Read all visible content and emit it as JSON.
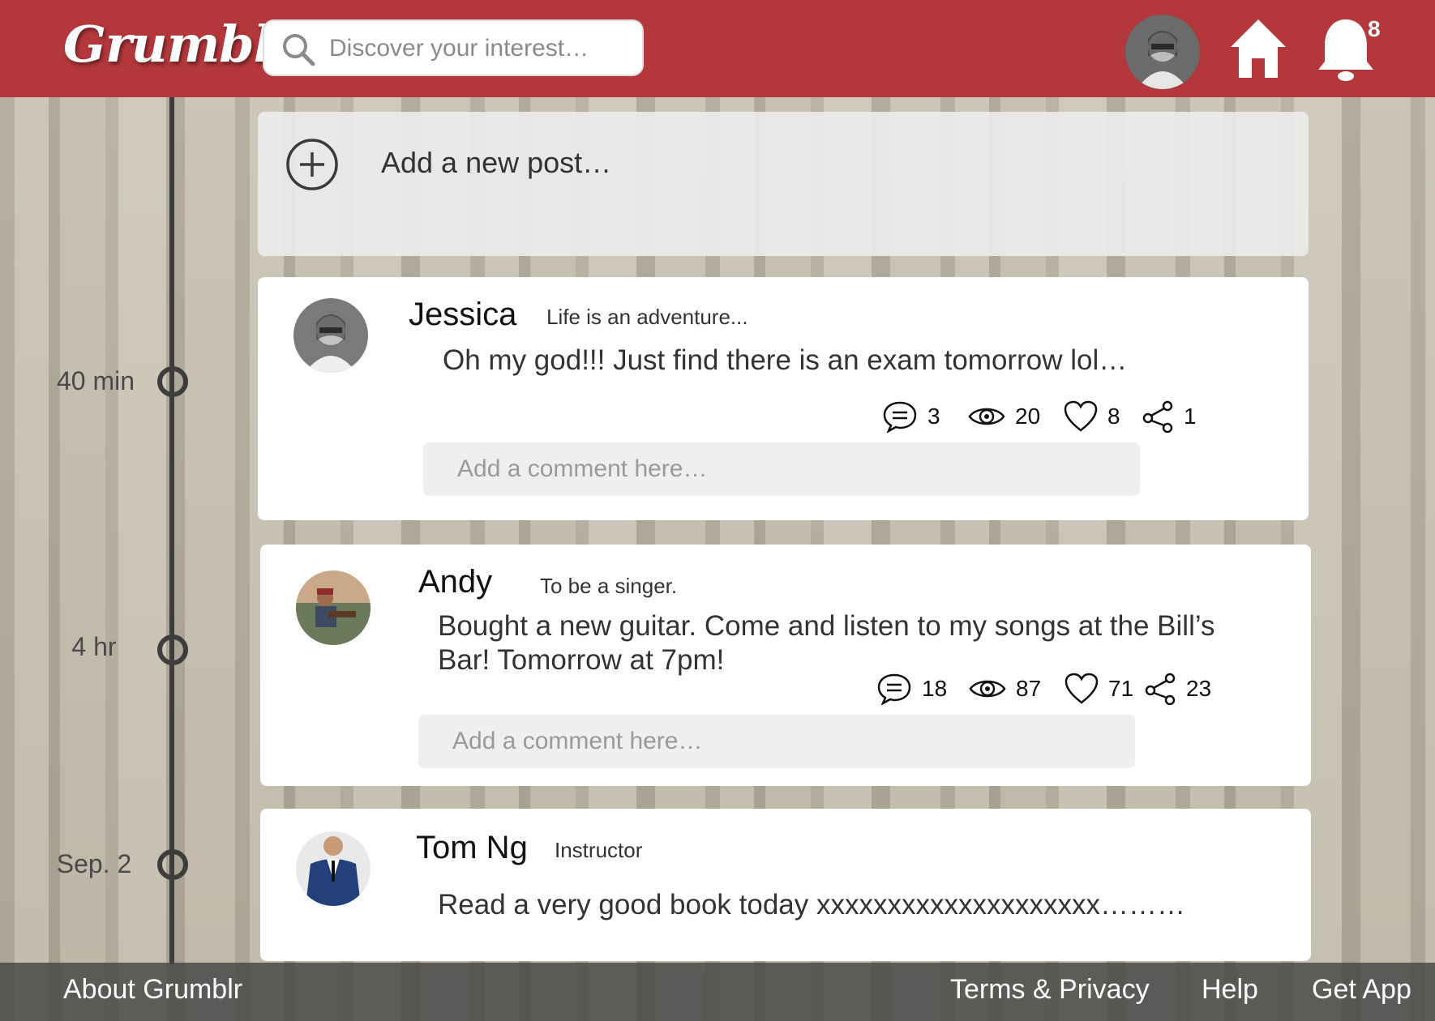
{
  "header": {
    "logo": "Grumblr",
    "search_placeholder": "Discover your interest…",
    "notification_count": "8"
  },
  "new_post": {
    "label": "Add a new post…"
  },
  "timeline": [
    {
      "label": "40 min"
    },
    {
      "label": "4 hr"
    },
    {
      "label": "Sep. 2"
    }
  ],
  "posts": [
    {
      "name": "Jessica",
      "tagline": "Life is an adventure...",
      "text": "Oh my god!!! Just find there is an exam tomorrow lol…",
      "comments": "3",
      "views": "20",
      "likes": "8",
      "shares": "1",
      "comment_placeholder": "Add a comment here…"
    },
    {
      "name": "Andy",
      "tagline": "To be a singer.",
      "text": "Bought a new guitar. Come and listen to my songs at the Bill’s Bar! Tomorrow at 7pm!",
      "comments": "18",
      "views": "87",
      "likes": "71",
      "shares": "23",
      "comment_placeholder": "Add a comment here…"
    },
    {
      "name": "Tom Ng",
      "tagline": "Instructor",
      "text": "Read a very good book today xxxxxxxxxxxxxxxxxxxx………"
    }
  ],
  "footer": {
    "about": "About Grumblr",
    "terms": "Terms & Privacy",
    "help": "Help",
    "get_app": "Get App"
  },
  "colors": {
    "brand": "#b3373b"
  },
  "icons": [
    "search-icon",
    "home-icon",
    "bell-icon",
    "plus-circle-icon",
    "comment-icon",
    "eye-icon",
    "heart-icon",
    "share-icon"
  ]
}
